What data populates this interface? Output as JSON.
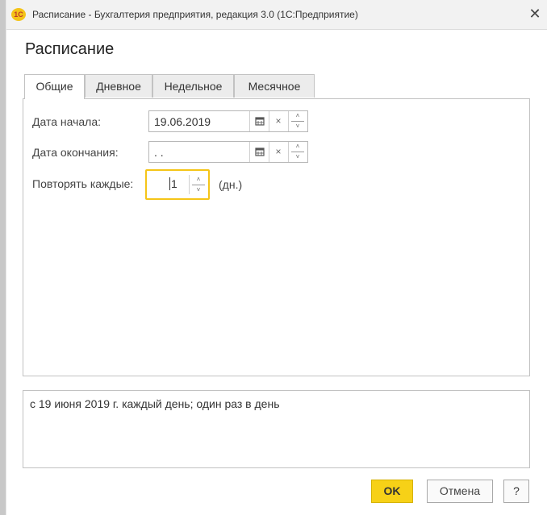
{
  "window": {
    "title": "Расписание - Бухгалтерия предприятия, редакция 3.0  (1С:Предприятие)",
    "logo_text": "1С",
    "close_glyph": "✕"
  },
  "form": {
    "title": "Расписание"
  },
  "tabs": [
    {
      "label": "Общие",
      "active": true
    },
    {
      "label": "Дневное",
      "active": false
    },
    {
      "label": "Недельное",
      "active": false
    },
    {
      "label": "Месячное",
      "active": false
    }
  ],
  "general": {
    "start_date_label": "Дата начала:",
    "start_date_value": "19.06.2019",
    "end_date_label": "Дата окончания:",
    "end_date_value": " .  .",
    "repeat_label": "Повторять каждые:",
    "repeat_value": "1",
    "repeat_unit": "(дн.)"
  },
  "summary": {
    "text": "с 19 июня 2019 г. каждый день; один раз в день"
  },
  "buttons": {
    "ok": "OK",
    "cancel": "Отмена",
    "help": "?"
  },
  "colors": {
    "accent": "#f5c518",
    "ok_button": "#f7d117"
  }
}
